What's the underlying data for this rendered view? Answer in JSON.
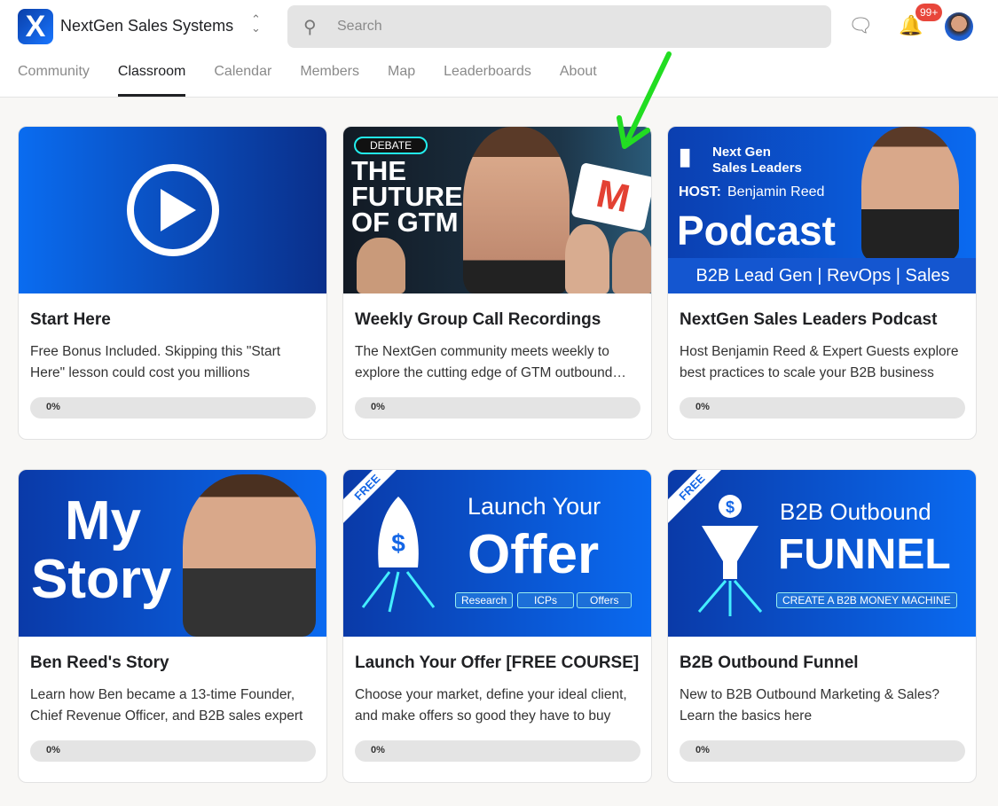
{
  "header": {
    "brand": "NextGen Sales Systems",
    "logo_letter": "X",
    "search_placeholder": "Search",
    "notification_count": "99+"
  },
  "tabs": [
    {
      "label": "Community"
    },
    {
      "label": "Classroom",
      "active": true
    },
    {
      "label": "Calendar"
    },
    {
      "label": "Members"
    },
    {
      "label": "Map"
    },
    {
      "label": "Leaderboards"
    },
    {
      "label": "About"
    }
  ],
  "courses": [
    {
      "title": "Start Here",
      "description": "Free Bonus Included. Skipping this \"Start Here\" lesson could cost you millions",
      "progress": 0,
      "progress_label": "0%"
    },
    {
      "title": "Weekly Group Call Recordings",
      "description": "The NextGen community meets weekly to explore the cutting edge of GTM outbound…",
      "progress": 0,
      "progress_label": "0%",
      "thumb": {
        "tag": "DEBATE",
        "l1": "THE",
        "l2": "FUTURE",
        "l3": "OF GTM"
      }
    },
    {
      "title": "NextGen Sales Leaders Podcast",
      "description": "Host Benjamin Reed & Expert Guests explore best practices to scale your B2B business",
      "progress": 0,
      "progress_label": "0%",
      "thumb": {
        "brand1": "Next Gen",
        "brand2": "Sales Leaders",
        "host_label": "HOST:",
        "host": "Benjamin Reed",
        "big": "Podcast",
        "bar": "B2B Lead Gen | RevOps | Sales"
      }
    },
    {
      "title": "Ben Reed's Story",
      "description": "Learn how Ben became a 13-time Founder, Chief Revenue Officer, and B2B sales expert",
      "progress": 0,
      "progress_label": "0%",
      "thumb": {
        "l1": "My",
        "l2": "Story"
      }
    },
    {
      "title": "Launch Your Offer [FREE COURSE]",
      "description": "Choose your market, define your ideal client, and make offers so good they have to buy",
      "progress": 0,
      "progress_label": "0%",
      "thumb": {
        "ribbon": "FREE",
        "l1": "Launch Your",
        "l2": "Offer",
        "pills": [
          "Research",
          "ICPs",
          "Offers"
        ]
      }
    },
    {
      "title": "B2B Outbound Funnel",
      "description": "New to B2B Outbound Marketing & Sales? Learn the basics here",
      "progress": 0,
      "progress_label": "0%",
      "thumb": {
        "ribbon": "FREE",
        "l1": "B2B Outbound",
        "l2": "FUNNEL",
        "pill": "CREATE A B2B MONEY MACHINE"
      }
    }
  ],
  "colors": {
    "accent": "#1466e6",
    "badge": "#e8463b",
    "annotation": "#22dd22"
  }
}
